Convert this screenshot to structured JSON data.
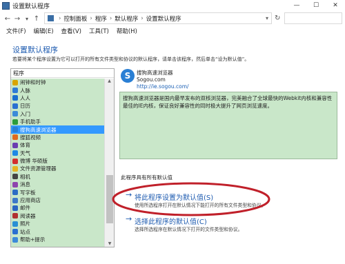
{
  "window": {
    "title": "设置默认程序"
  },
  "window_controls": {
    "minimize": "—",
    "maximize": "☐",
    "close": "✕"
  },
  "nav": {
    "back": "←",
    "forward": "→",
    "up": "↑",
    "dropdown": "▾",
    "refresh": "↻"
  },
  "breadcrumb": [
    "控制面板",
    "程序",
    "默认程序",
    "设置默认程序"
  ],
  "menu": [
    "文件(F)",
    "编辑(E)",
    "查看(V)",
    "工具(T)",
    "帮助(H)"
  ],
  "page": {
    "heading": "设置默认程序",
    "description": "若要将某个程序设置为它可以打开的所有文件类型和协议的默认程序，请单击该程序，然后单击“设为默认值”。"
  },
  "program_list": {
    "header": "程序",
    "items": [
      {
        "label": "闹钟和时钟",
        "icon_color": "#d9a400"
      },
      {
        "label": "人脉",
        "icon_color": "#2e7bd6"
      },
      {
        "label": "人人",
        "icon_color": "#1a6fcf"
      },
      {
        "label": "日历",
        "icon_color": "#2a6fd1"
      },
      {
        "label": "入门",
        "icon_color": "#3c8ad8"
      },
      {
        "label": "手机助手",
        "icon_color": "#2d9c3c"
      },
      {
        "label": "搜狗高速浏览器",
        "icon_color": "#2a7fd4",
        "selected": true
      },
      {
        "label": "搜狐视频",
        "icon_color": "#e06b1f"
      },
      {
        "label": "体育",
        "icon_color": "#6a3db0"
      },
      {
        "label": "天气",
        "icon_color": "#1e88e5"
      },
      {
        "label": "微博 华硕版",
        "icon_color": "#d32f2f"
      },
      {
        "label": "文件资源管理器",
        "icon_color": "#e6b422"
      },
      {
        "label": "相机",
        "icon_color": "#444444"
      },
      {
        "label": "消息",
        "icon_color": "#8e44ad"
      },
      {
        "label": "写字板",
        "icon_color": "#2b6cc4"
      },
      {
        "label": "应用商店",
        "icon_color": "#3c78c8"
      },
      {
        "label": "邮件",
        "icon_color": "#2a66c2"
      },
      {
        "label": "阅读器",
        "icon_color": "#b03030"
      },
      {
        "label": "照片",
        "icon_color": "#2a8fd4"
      },
      {
        "label": "站点",
        "icon_color": "#2a6fd1"
      },
      {
        "label": "帮助+提示",
        "icon_color": "#3c8ad8"
      }
    ]
  },
  "program_detail": {
    "logo_glyph": "S",
    "name": "搜狗高速浏览器",
    "company": "Sogou.com",
    "url": "http://ie.sogou.com/",
    "description": "搜狗高速浏览器是国内最早发布的双核浏览器，完美融合了全球最快的Webkit内核和兼容性最佳的IE内核，保证良好兼容性的同时极大提升了网页浏览速度。",
    "defaults_status": "此程序具有所有默认值"
  },
  "options": [
    {
      "arrow": "→",
      "title": "将此程序设置为默认值(S)",
      "subtitle": "使用所选程序打开在默认情况下能打开的所有文件类型和协议。"
    },
    {
      "arrow": "→",
      "title": "选择此程序的默认值(C)",
      "subtitle": "选择所选程序在默认情况下打开的文件类型和协议。"
    }
  ],
  "highlight_color": "#c0202a"
}
